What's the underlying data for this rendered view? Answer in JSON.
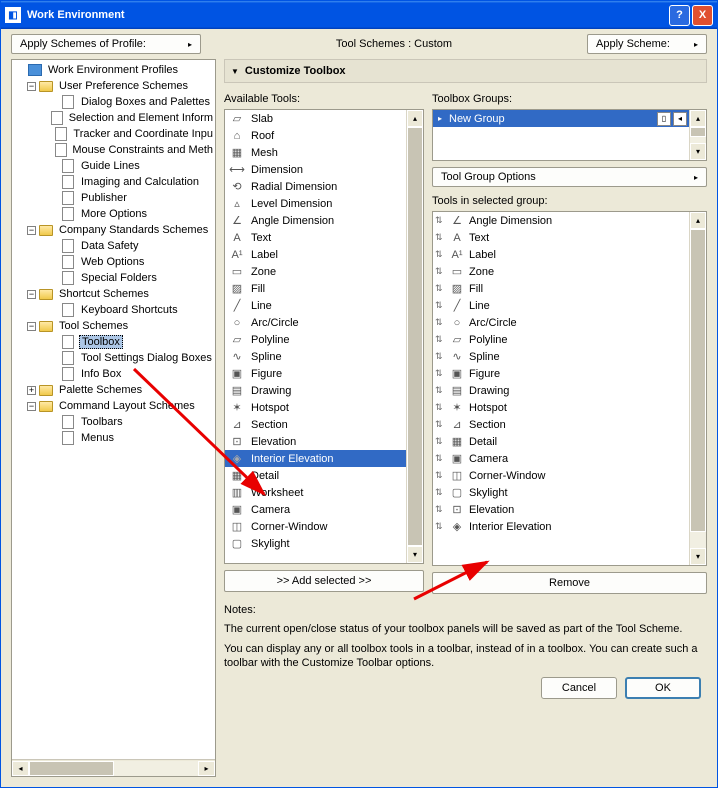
{
  "window": {
    "title": "Work Environment",
    "help": "?",
    "close": "X"
  },
  "toolbar": {
    "apply_profile": "Apply Schemes of Profile:",
    "mid_label": "Tool Schemes : Custom",
    "apply_scheme": "Apply Scheme:"
  },
  "tree": {
    "root": "Work Environment Profiles",
    "ups": "User Preference Schemes",
    "ups_items": [
      "Dialog Boxes and Palettes",
      "Selection and Element Inform",
      "Tracker and Coordinate Inpu",
      "Mouse Constraints and Meth",
      "Guide Lines",
      "Imaging and Calculation",
      "Publisher",
      "More Options"
    ],
    "css": "Company Standards Schemes",
    "css_items": [
      "Data Safety",
      "Web Options",
      "Special Folders"
    ],
    "ss": "Shortcut Schemes",
    "ss_items": [
      "Keyboard Shortcuts"
    ],
    "ts": "Tool Schemes",
    "ts_items": [
      "Toolbox",
      "Tool Settings Dialog Boxes",
      "Info Box"
    ],
    "ps": "Palette Schemes",
    "cls": "Command Layout Schemes",
    "cls_items": [
      "Toolbars",
      "Menus"
    ]
  },
  "section": {
    "title": "Customize Toolbox"
  },
  "available": {
    "label": "Available Tools:",
    "items": [
      {
        "icon": "▱",
        "name": "Slab"
      },
      {
        "icon": "⌂",
        "name": "Roof"
      },
      {
        "icon": "▦",
        "name": "Mesh"
      },
      {
        "icon": "⟷",
        "name": "Dimension"
      },
      {
        "icon": "⟲",
        "name": "Radial Dimension"
      },
      {
        "icon": "▵",
        "name": "Level Dimension"
      },
      {
        "icon": "∠",
        "name": "Angle Dimension"
      },
      {
        "icon": "A",
        "name": "Text"
      },
      {
        "icon": "A¹",
        "name": "Label"
      },
      {
        "icon": "▭",
        "name": "Zone"
      },
      {
        "icon": "▨",
        "name": "Fill"
      },
      {
        "icon": "╱",
        "name": "Line"
      },
      {
        "icon": "○",
        "name": "Arc/Circle"
      },
      {
        "icon": "▱",
        "name": "Polyline"
      },
      {
        "icon": "∿",
        "name": "Spline"
      },
      {
        "icon": "▣",
        "name": "Figure"
      },
      {
        "icon": "▤",
        "name": "Drawing"
      },
      {
        "icon": "✶",
        "name": "Hotspot"
      },
      {
        "icon": "⊿",
        "name": "Section"
      },
      {
        "icon": "⊡",
        "name": "Elevation"
      },
      {
        "icon": "◈",
        "name": "Interior Elevation"
      },
      {
        "icon": "▦",
        "name": "Detail"
      },
      {
        "icon": "▥",
        "name": "Worksheet"
      },
      {
        "icon": "▣",
        "name": "Camera"
      },
      {
        "icon": "◫",
        "name": "Corner-Window"
      },
      {
        "icon": "▢",
        "name": "Skylight"
      }
    ],
    "selected_index": 20,
    "add_btn": ">> Add selected >>"
  },
  "groups": {
    "label": "Toolbox Groups:",
    "items": [
      {
        "name": "New Group"
      }
    ],
    "options_btn": "Tool Group Options"
  },
  "selected_tools": {
    "label": "Tools in selected group:",
    "items": [
      {
        "icon": "∠",
        "name": "Angle Dimension"
      },
      {
        "icon": "A",
        "name": "Text"
      },
      {
        "icon": "A¹",
        "name": "Label"
      },
      {
        "icon": "▭",
        "name": "Zone"
      },
      {
        "icon": "▨",
        "name": "Fill"
      },
      {
        "icon": "╱",
        "name": "Line"
      },
      {
        "icon": "○",
        "name": "Arc/Circle"
      },
      {
        "icon": "▱",
        "name": "Polyline"
      },
      {
        "icon": "∿",
        "name": "Spline"
      },
      {
        "icon": "▣",
        "name": "Figure"
      },
      {
        "icon": "▤",
        "name": "Drawing"
      },
      {
        "icon": "✶",
        "name": "Hotspot"
      },
      {
        "icon": "⊿",
        "name": "Section"
      },
      {
        "icon": "▦",
        "name": "Detail"
      },
      {
        "icon": "▣",
        "name": "Camera"
      },
      {
        "icon": "◫",
        "name": "Corner-Window"
      },
      {
        "icon": "▢",
        "name": "Skylight"
      },
      {
        "icon": "⊡",
        "name": "Elevation"
      },
      {
        "icon": "◈",
        "name": "Interior Elevation"
      }
    ],
    "remove_btn": "Remove"
  },
  "notes": {
    "heading": "Notes:",
    "p1": "The current open/close status of your toolbox panels will be saved as part of the Tool Scheme.",
    "p2": "You can display any or all toolbox tools in a toolbar, instead of in a toolbox. You can create such a toolbar with the Customize Toolbar options."
  },
  "footer": {
    "cancel": "Cancel",
    "ok": "OK"
  }
}
